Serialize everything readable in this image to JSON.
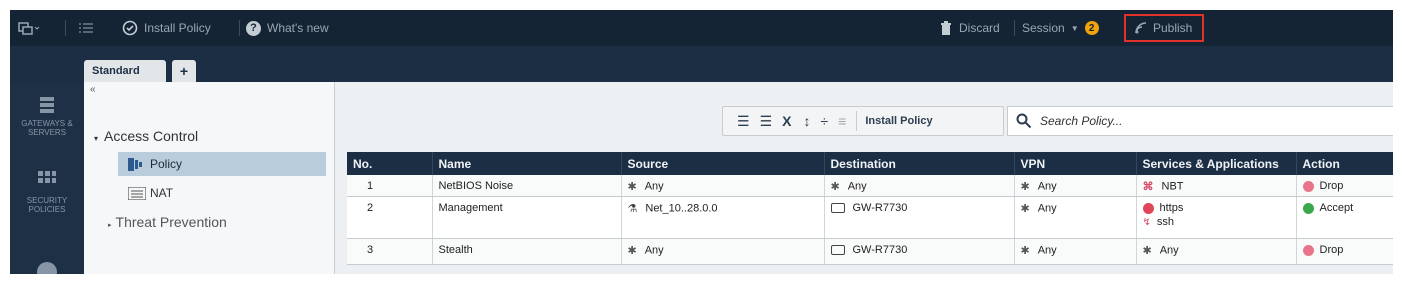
{
  "topbar": {
    "install_policy": "Install Policy",
    "whats_new": "What's new",
    "discard": "Discard",
    "session": "Session",
    "session_count": "2",
    "publish": "Publish"
  },
  "tabs": {
    "standard": "Standard",
    "add": "+"
  },
  "rail": {
    "gateways": "GATEWAYS & SERVERS",
    "security": "SECURITY POLICIES"
  },
  "tree": {
    "access_control": "Access Control",
    "policy": "Policy",
    "nat": "NAT",
    "threat_prevention": "Threat Prevention"
  },
  "toolbar": {
    "install_policy": "Install Policy",
    "delete_glyph": "X"
  },
  "search": {
    "placeholder": "Search Policy..."
  },
  "table": {
    "headers": [
      "No.",
      "Name",
      "Source",
      "Destination",
      "VPN",
      "Services & Applications",
      "Action"
    ],
    "rows": [
      {
        "no": "1",
        "name": "NetBIOS Noise",
        "source": "Any",
        "destination": "Any",
        "vpn": "Any",
        "services": [
          "NBT"
        ],
        "action": "Drop"
      },
      {
        "no": "2",
        "name": "Management",
        "source": "Net_10..28.0.0",
        "destination": "GW-R7730",
        "vpn": "Any",
        "services": [
          "https",
          "ssh"
        ],
        "action": "Accept"
      },
      {
        "no": "3",
        "name": "Stealth",
        "source": "Any",
        "destination": "GW-R7730",
        "vpn": "Any",
        "services": [
          "Any"
        ],
        "action": "Drop"
      }
    ]
  },
  "colors": {
    "accent_dark": "#1b2e44",
    "publish_highlight": "#e0322a",
    "drop": "#e8748a",
    "accept": "#3aa84a",
    "session_badge": "#f0a30a"
  }
}
